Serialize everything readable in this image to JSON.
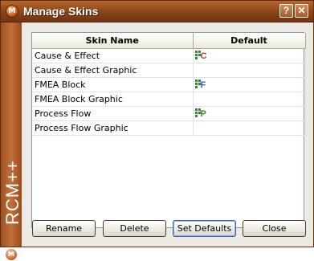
{
  "window": {
    "title": "Manage Skins",
    "help_glyph": "?",
    "close_glyph": "✕",
    "app_icon_glyph": "M"
  },
  "brand": {
    "text": "RCM++",
    "logo_glyph": "M"
  },
  "table": {
    "columns": [
      "Skin Name",
      "Default"
    ],
    "rows": [
      {
        "name": "Cause & Effect",
        "default_icon": "cause-effect-icon",
        "icon_letter": "C",
        "icon_color": "#c0392b"
      },
      {
        "name": "Cause & Effect Graphic",
        "default_icon": ""
      },
      {
        "name": "FMEA Block",
        "default_icon": "fmea-block-icon",
        "icon_letter": "F",
        "icon_color": "#2a5bd7"
      },
      {
        "name": "FMEA Block Graphic",
        "default_icon": ""
      },
      {
        "name": "Process Flow",
        "default_icon": "process-flow-icon",
        "icon_letter": "P",
        "icon_color": "#2e8b2e"
      },
      {
        "name": "Process Flow Graphic",
        "default_icon": ""
      }
    ]
  },
  "buttons": {
    "rename": "Rename",
    "delete": "Delete",
    "set_defaults": "Set Defaults",
    "close": "Close"
  },
  "colors": {
    "titlebar": "#8f4a1b",
    "brand_strip": "#b3612c",
    "icon_squares": "#2e8b2e"
  }
}
